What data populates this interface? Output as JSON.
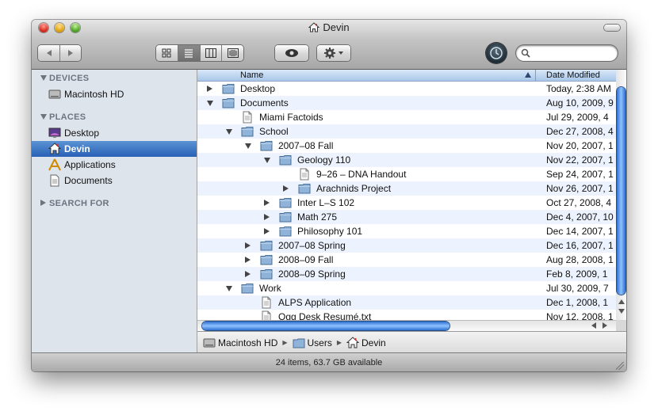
{
  "window": {
    "title": "Devin"
  },
  "toolbar": {
    "back_icon": "back-arrow-icon",
    "forward_icon": "forward-arrow-icon",
    "view_modes": [
      "icon-view",
      "list-view",
      "column-view",
      "cover-flow-view"
    ],
    "active_view": "list-view",
    "quicklook_icon": "eye-icon",
    "action_icon": "gear-icon",
    "search": {
      "value": "",
      "placeholder": ""
    }
  },
  "sidebar": {
    "sections": [
      {
        "label": "DEVICES",
        "items": [
          {
            "label": "Macintosh HD",
            "icon": "hard-drive-icon"
          }
        ]
      },
      {
        "label": "PLACES",
        "items": [
          {
            "label": "Desktop",
            "icon": "desktop-icon"
          },
          {
            "label": "Devin",
            "icon": "home-icon",
            "selected": true
          },
          {
            "label": "Applications",
            "icon": "applications-icon"
          },
          {
            "label": "Documents",
            "icon": "document-icon"
          }
        ]
      },
      {
        "label": "SEARCH FOR",
        "items": []
      }
    ]
  },
  "list": {
    "columns": {
      "name": "Name",
      "date": "Date Modified"
    },
    "rows": [
      {
        "name": "Desktop",
        "date": "Today, 2:38 AM",
        "level": 0,
        "kind": "folder",
        "disclosure": "closed"
      },
      {
        "name": "Documents",
        "date": "Aug 10, 2009, 9",
        "level": 0,
        "kind": "folder",
        "disclosure": "open"
      },
      {
        "name": "Miami Factoids",
        "date": "Jul 29, 2009, 4",
        "level": 1,
        "kind": "doc",
        "disclosure": "none"
      },
      {
        "name": "School",
        "date": "Dec 27, 2008, 4",
        "level": 1,
        "kind": "folder",
        "disclosure": "open"
      },
      {
        "name": "2007–08 Fall",
        "date": "Nov 20, 2007, 1",
        "level": 2,
        "kind": "folder",
        "disclosure": "open"
      },
      {
        "name": "Geology 110",
        "date": "Nov 22, 2007, 1",
        "level": 3,
        "kind": "folder",
        "disclosure": "open"
      },
      {
        "name": "9–26 – DNA Handout",
        "date": "Sep 24, 2007, 1",
        "level": 4,
        "kind": "doc",
        "disclosure": "none"
      },
      {
        "name": "Arachnids Project",
        "date": "Nov 26, 2007, 1",
        "level": 4,
        "kind": "folder",
        "disclosure": "closed"
      },
      {
        "name": "Inter L–S 102",
        "date": "Oct 27, 2008, 4",
        "level": 3,
        "kind": "folder",
        "disclosure": "closed"
      },
      {
        "name": "Math 275",
        "date": "Dec 4, 2007, 10",
        "level": 3,
        "kind": "folder",
        "disclosure": "closed"
      },
      {
        "name": "Philosophy 101",
        "date": "Dec 14, 2007, 1",
        "level": 3,
        "kind": "folder",
        "disclosure": "closed"
      },
      {
        "name": "2007–08 Spring",
        "date": "Dec 16, 2007, 1",
        "level": 2,
        "kind": "folder",
        "disclosure": "closed"
      },
      {
        "name": "2008–09 Fall",
        "date": "Aug 28, 2008, 1",
        "level": 2,
        "kind": "folder",
        "disclosure": "closed"
      },
      {
        "name": "2008–09 Spring",
        "date": "Feb 8, 2009, 1",
        "level": 2,
        "kind": "folder",
        "disclosure": "closed"
      },
      {
        "name": "Work",
        "date": "Jul 30, 2009, 7",
        "level": 1,
        "kind": "folder",
        "disclosure": "open"
      },
      {
        "name": "ALPS Application",
        "date": "Dec 1, 2008, 1",
        "level": 2,
        "kind": "doc",
        "disclosure": "none"
      },
      {
        "name": "Ogg Desk Resumé.txt",
        "date": "Nov 12, 2008, 1",
        "level": 2,
        "kind": "doc",
        "disclosure": "none"
      }
    ]
  },
  "pathbar": [
    {
      "label": "Macintosh HD",
      "icon": "hard-drive-icon"
    },
    {
      "label": "Users",
      "icon": "folder-icon"
    },
    {
      "label": "Devin",
      "icon": "home-icon"
    }
  ],
  "status": {
    "text": "24 items, 63.7 GB available"
  },
  "colors": {
    "selection": "#2861b6",
    "row_alt": "#edf3fe",
    "sidebar_bg": "#dde4ec"
  }
}
